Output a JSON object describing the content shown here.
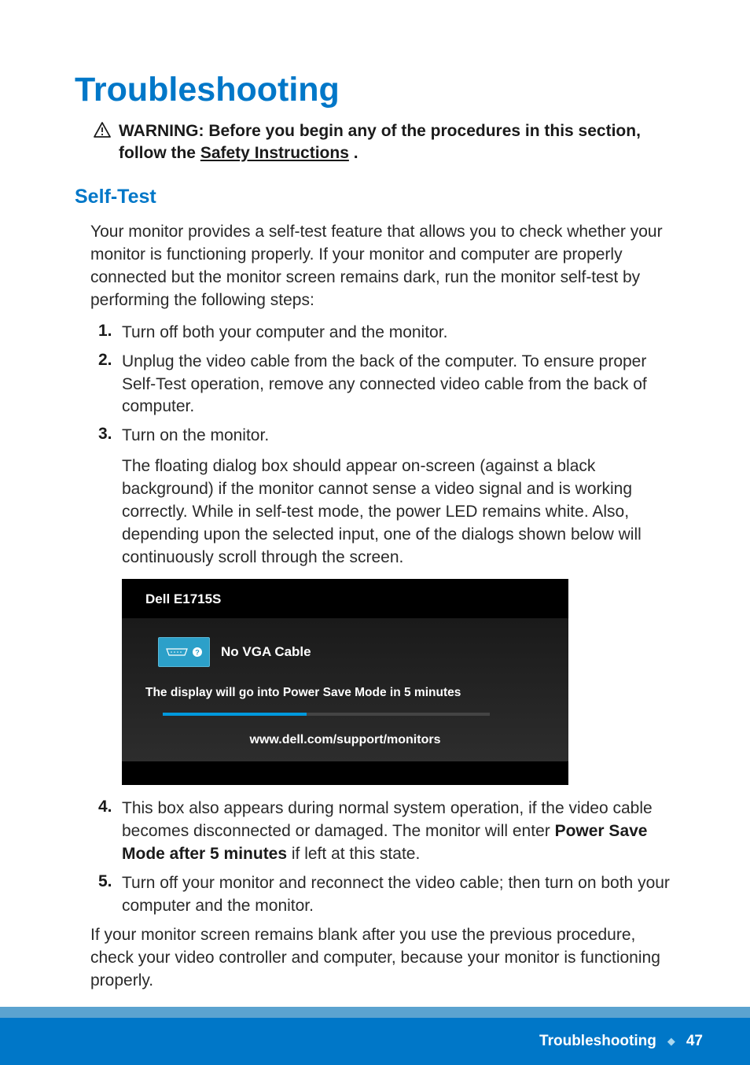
{
  "title": "Troubleshooting",
  "warning": {
    "label": "WARNING: Before you begin any of the procedures in this section, follow the ",
    "link_text": "Safety Instructions",
    "suffix": " ."
  },
  "section": {
    "heading": "Self-Test",
    "intro": "Your monitor provides a self-test feature that allows you to check whether your monitor is functioning properly. If your monitor and computer are properly connected but the monitor screen remains dark, run the monitor self-test by performing the following steps:",
    "steps": {
      "1": {
        "num": "1.",
        "text": "Turn off both your computer and the monitor."
      },
      "2": {
        "num": "2.",
        "text": "Unplug the video cable from the back of the computer. To ensure proper Self-Test operation, remove any connected video cable from the back of computer."
      },
      "3": {
        "num": "3.",
        "text": "Turn on the monitor."
      },
      "sub_after_3": "The floating dialog box should appear on-screen (against a black background) if the monitor cannot sense a video signal and is working correctly. While in self-test mode, the power LED remains white. Also, depending upon the selected input, one of the dialogs shown below will continuously scroll through the screen.",
      "4": {
        "num": "4.",
        "text_a": "This box also appears during normal system operation, if the video cable becomes disconnected or damaged. The monitor will enter ",
        "bold": "Power Save Mode after 5 minutes",
        "text_b": " if left at this state."
      },
      "5": {
        "num": "5.",
        "text": "Turn off your monitor and reconnect the video cable; then turn on both your computer and the monitor."
      }
    },
    "closing": "If your monitor screen remains blank after you use the previous procedure, check your video controller and computer, because your monitor is functioning properly."
  },
  "dialog": {
    "model": "Dell E1715S",
    "no_cable_label": "No VGA Cable",
    "power_save_msg": "The display will go into Power Save Mode in 5 minutes",
    "support_url": "www.dell.com/support/monitors"
  },
  "footer": {
    "section_name": "Troubleshooting",
    "page": "47"
  }
}
